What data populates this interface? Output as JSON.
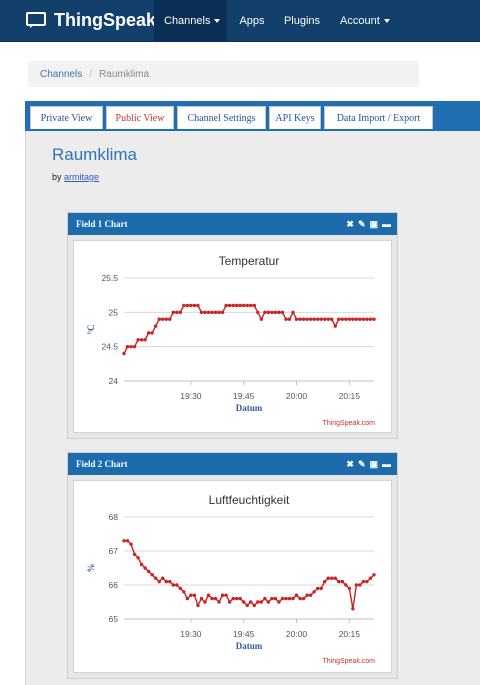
{
  "brand": "ThingSpeak",
  "nav": [
    {
      "label": "Channels",
      "dropdown": true
    },
    {
      "label": "Apps",
      "dropdown": false
    },
    {
      "label": "Plugins",
      "dropdown": false
    },
    {
      "label": "Account",
      "dropdown": true
    }
  ],
  "breadcrumb": {
    "parent": "Channels",
    "sep": "/",
    "current": "Raumklima"
  },
  "tabs": [
    "Private View",
    "Public View",
    "Channel Settings",
    "API Keys",
    "Data Import / Export"
  ],
  "active_tab": "Public View",
  "channel": {
    "title": "Raumklima",
    "by_label": "by",
    "author": "armitage"
  },
  "colors": {
    "nav": "#133f6b",
    "tabbar": "#1f6fb2",
    "widget_header": "#1c6bac",
    "series": "#cc2222"
  },
  "widgets": [
    {
      "header": "Field 1 Chart",
      "icons": [
        "close-icon",
        "edit-icon",
        "comment-icon",
        "minimize-icon"
      ]
    },
    {
      "header": "Field 2 Chart",
      "icons": [
        "close-icon",
        "edit-icon",
        "comment-icon",
        "minimize-icon"
      ]
    }
  ],
  "chart_data": [
    {
      "type": "line",
      "title": "Temperatur",
      "xlabel": "Datum",
      "ylabel": "°C",
      "credit": "ThingSpeak.com",
      "ylim": [
        24,
        25.5
      ],
      "yticks": [
        24,
        24.5,
        25,
        25.5
      ],
      "ytick_labels": [
        "24",
        "24.5",
        "25",
        "25.5"
      ],
      "xlim": [
        11,
        82
      ],
      "xticks": [
        30,
        45,
        60,
        75
      ],
      "xtick_labels": [
        "19:30",
        "19:45",
        "20:00",
        "20:15"
      ],
      "x": [
        11,
        12,
        13,
        14,
        15,
        16,
        17,
        18,
        19,
        20,
        21,
        22,
        23,
        24,
        25,
        26,
        27,
        28,
        29,
        30,
        31,
        32,
        33,
        34,
        35,
        36,
        37,
        38,
        39,
        40,
        41,
        42,
        43,
        44,
        45,
        46,
        47,
        48,
        49,
        50,
        51,
        52,
        53,
        54,
        55,
        56,
        57,
        58,
        59,
        60,
        61,
        62,
        63,
        64,
        65,
        66,
        67,
        68,
        69,
        70,
        71,
        72,
        73,
        74,
        75,
        76,
        77,
        78,
        79,
        80,
        81,
        82
      ],
      "values": [
        24.4,
        24.5,
        24.5,
        24.5,
        24.6,
        24.6,
        24.6,
        24.7,
        24.7,
        24.8,
        24.9,
        24.9,
        24.9,
        24.9,
        25.0,
        25.0,
        25.0,
        25.1,
        25.1,
        25.1,
        25.1,
        25.1,
        25.0,
        25.0,
        25.0,
        25.0,
        25.0,
        25.0,
        25.0,
        25.1,
        25.1,
        25.1,
        25.1,
        25.1,
        25.1,
        25.1,
        25.1,
        25.1,
        25.0,
        24.9,
        25.0,
        25.0,
        25.0,
        25.0,
        25.0,
        25.0,
        24.9,
        24.9,
        25.0,
        24.9,
        24.9,
        24.9,
        24.9,
        24.9,
        24.9,
        24.9,
        24.9,
        24.9,
        24.9,
        24.9,
        24.8,
        24.9,
        24.9,
        24.9,
        24.9,
        24.9,
        24.9,
        24.9,
        24.9,
        24.9,
        24.9,
        24.9
      ],
      "grid": true
    },
    {
      "type": "line",
      "title": "Luftfeuchtigkeit",
      "xlabel": "Datum",
      "ylabel": "%",
      "credit": "ThingSpeak.com",
      "ylim": [
        65,
        68
      ],
      "yticks": [
        65,
        66,
        67,
        68
      ],
      "ytick_labels": [
        "65",
        "66",
        "67",
        "68"
      ],
      "xlim": [
        11,
        82
      ],
      "xticks": [
        30,
        45,
        60,
        75
      ],
      "xtick_labels": [
        "19:30",
        "19:45",
        "20:00",
        "20:15"
      ],
      "x": [
        11,
        12,
        13,
        14,
        15,
        16,
        17,
        18,
        19,
        20,
        21,
        22,
        23,
        24,
        25,
        26,
        27,
        28,
        29,
        30,
        31,
        32,
        33,
        34,
        35,
        36,
        37,
        38,
        39,
        40,
        41,
        42,
        43,
        44,
        45,
        46,
        47,
        48,
        49,
        50,
        51,
        52,
        53,
        54,
        55,
        56,
        57,
        58,
        59,
        60,
        61,
        62,
        63,
        64,
        65,
        66,
        67,
        68,
        69,
        70,
        71,
        72,
        73,
        74,
        75,
        76,
        77,
        78,
        79,
        80,
        81,
        82
      ],
      "values": [
        67.3,
        67.3,
        67.2,
        66.9,
        66.8,
        66.6,
        66.5,
        66.4,
        66.3,
        66.2,
        66.1,
        66.2,
        66.1,
        66.1,
        66.0,
        66.0,
        65.9,
        65.8,
        65.6,
        65.7,
        65.7,
        65.4,
        65.6,
        65.5,
        65.7,
        65.6,
        65.6,
        65.5,
        65.7,
        65.7,
        65.5,
        65.6,
        65.6,
        65.6,
        65.5,
        65.4,
        65.5,
        65.4,
        65.5,
        65.5,
        65.6,
        65.5,
        65.6,
        65.6,
        65.5,
        65.6,
        65.6,
        65.6,
        65.6,
        65.7,
        65.6,
        65.6,
        65.7,
        65.7,
        65.8,
        65.9,
        65.9,
        66.1,
        66.2,
        66.2,
        66.2,
        66.1,
        66.1,
        66.0,
        65.9,
        65.3,
        66.0,
        66.0,
        66.1,
        66.1,
        66.2,
        66.3
      ],
      "grid": true
    }
  ]
}
